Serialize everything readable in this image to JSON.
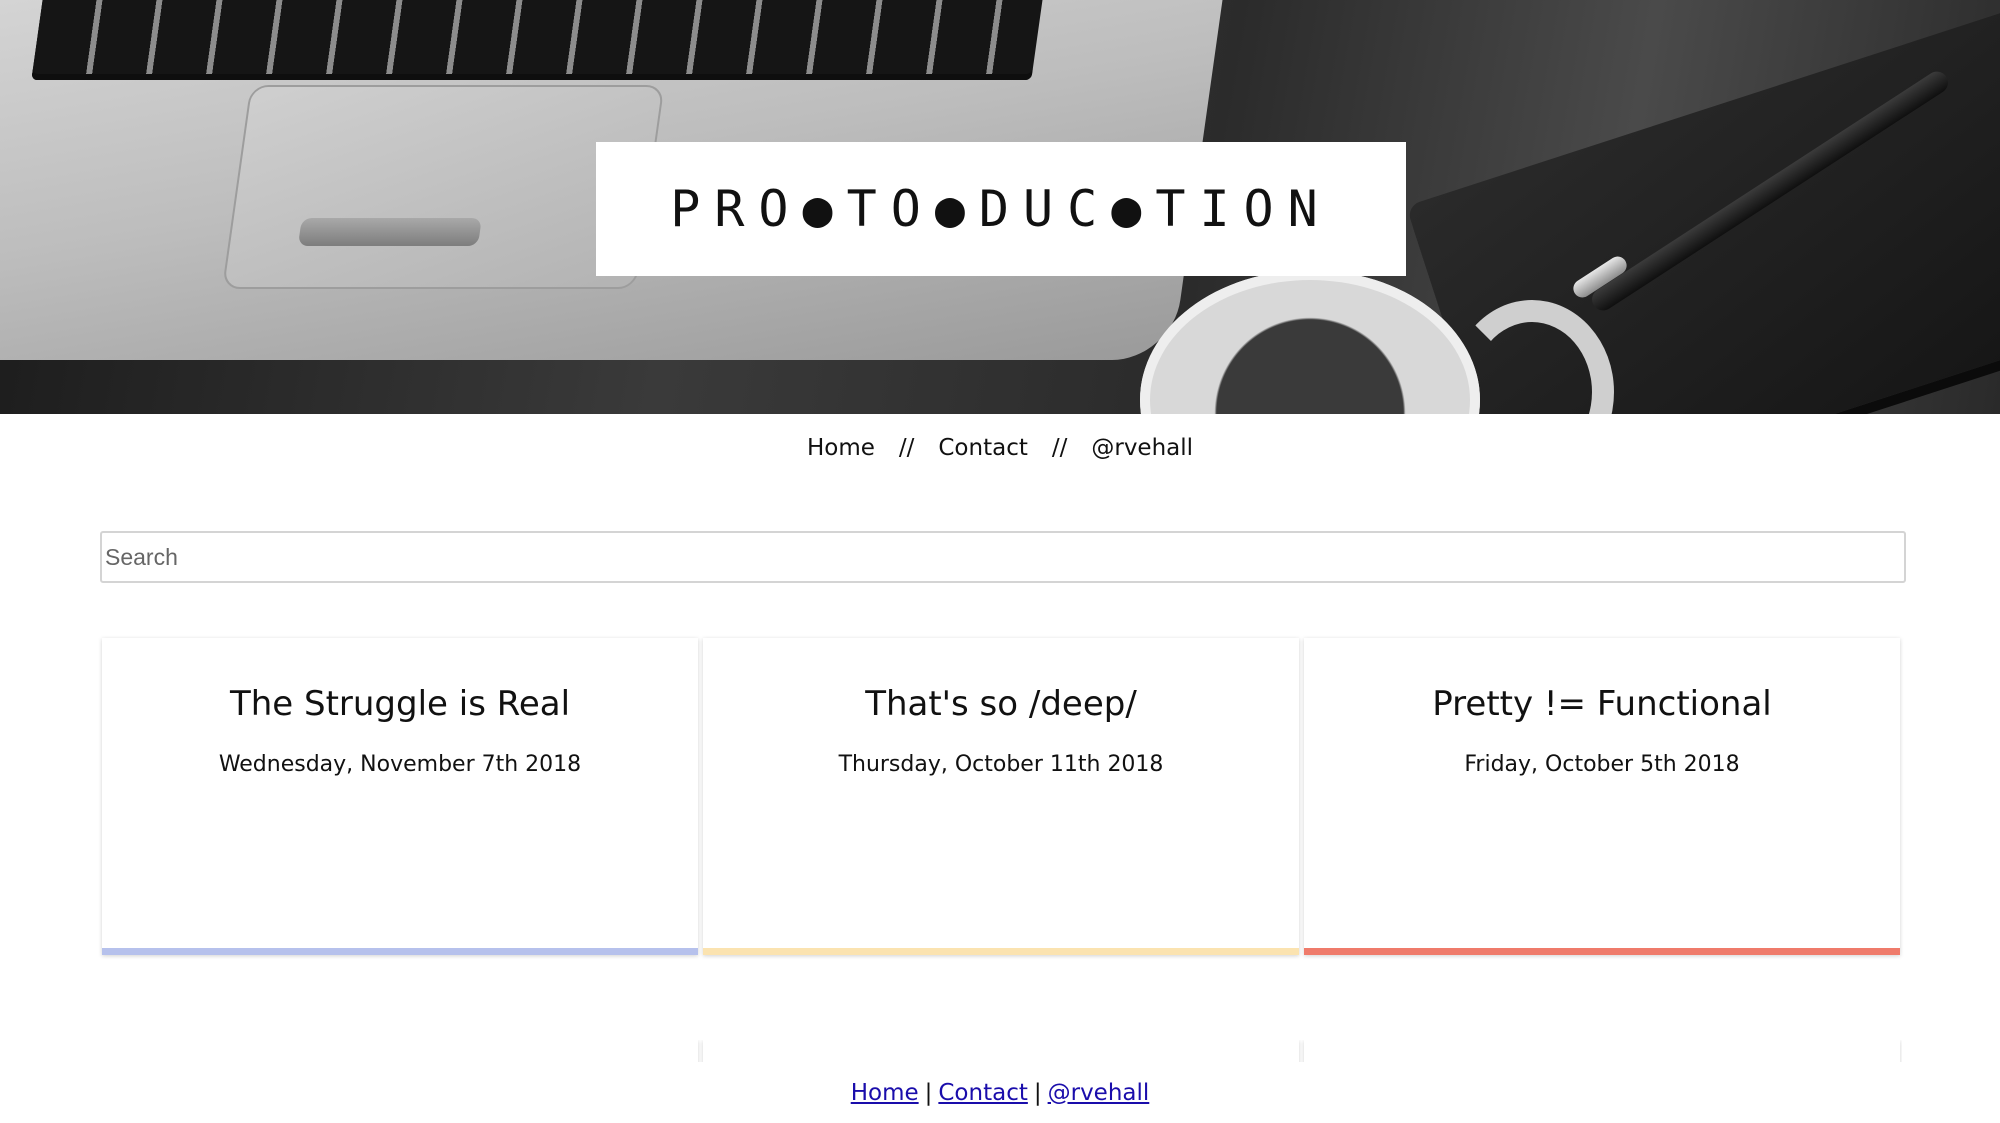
{
  "header": {
    "site_title": "PRO●TO●DUC●TION"
  },
  "nav": {
    "items": [
      "Home",
      "Contact",
      "@rvehall"
    ],
    "separator": "//"
  },
  "search": {
    "placeholder": "Search",
    "value": ""
  },
  "posts": [
    {
      "title": "The Struggle is Real",
      "date": "Wednesday, November 7th 2018",
      "accent_color": "#b6c1ec"
    },
    {
      "title": "That's so /deep/",
      "date": "Thursday, October 11th 2018",
      "accent_color": "#fbe3b0"
    },
    {
      "title": "Pretty != Functional",
      "date": "Friday, October 5th 2018",
      "accent_color": "#ef7b6b"
    }
  ],
  "footer": {
    "links": [
      "Home",
      "Contact",
      "@rvehall"
    ],
    "separator": "|"
  }
}
